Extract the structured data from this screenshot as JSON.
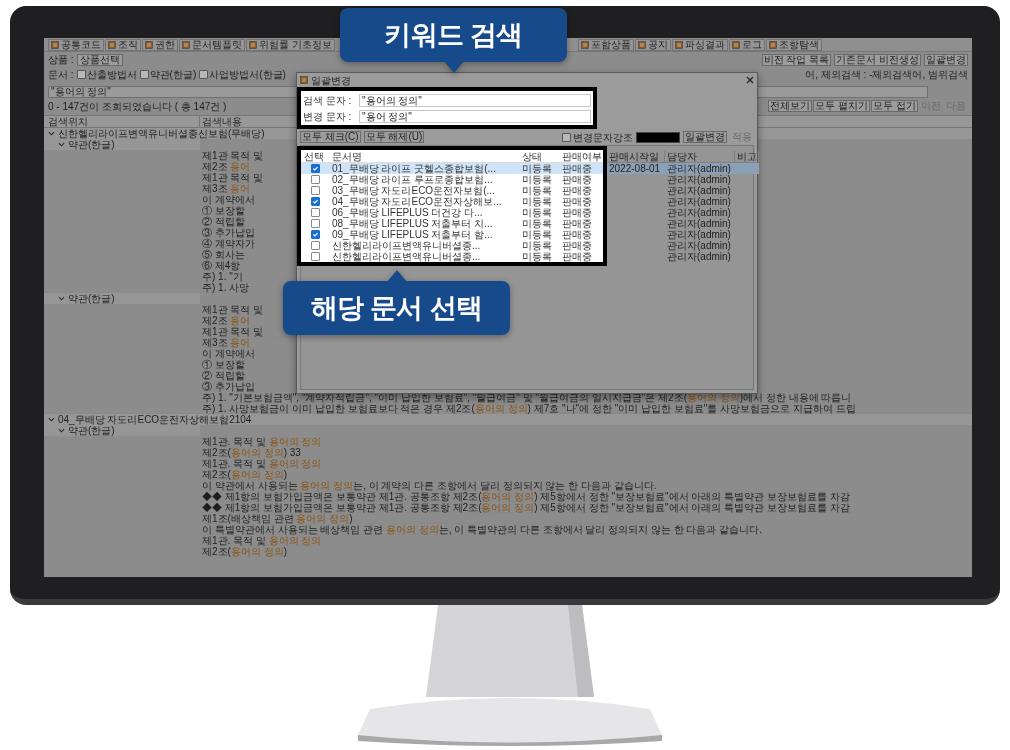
{
  "callouts": [
    {
      "text": "키워드 검색",
      "kind": "down"
    },
    {
      "text": "해당 문서 선택",
      "kind": "up"
    }
  ],
  "app": {
    "tabs_left": [
      "공통코드",
      "조직",
      "권한",
      "문서템플릿",
      "위험률 기초정보"
    ],
    "tabs_right": [
      "포함상품",
      "공지",
      "파싱결과",
      "로그",
      "조항탐색"
    ],
    "product": {
      "label": "상품 :",
      "value": "상품선택"
    },
    "top_buttons": [
      "비전 작업 목록",
      "기존문서 비전생성",
      "일괄변경"
    ],
    "documents": {
      "label": "문서 :",
      "options": [
        {
          "label": "산출방법서",
          "checked": false
        },
        {
          "label": "약관(한글)",
          "checked": false
        },
        {
          "label": "사업방법서(한글)",
          "checked": false
        }
      ]
    },
    "search_hint": "어, 제외검색 : -제외검색어, 범위검색",
    "search_value": "\"용어의 정의\"",
    "result_count": "0 - 147건이 조회되었습니다 ( 총 147건 )",
    "result_buttons": [
      {
        "label": "전체보기",
        "disabled": false
      },
      {
        "label": "모두 펼치기",
        "disabled": false
      },
      {
        "label": "모두 접기",
        "disabled": false
      },
      {
        "label": "이전",
        "disabled": true
      },
      {
        "label": "다음",
        "disabled": true
      }
    ],
    "columns": [
      "검색위치",
      "검색내용"
    ],
    "groups": [
      {
        "title": "신한헬리라이프변액유니버셜종신보험(무배당)",
        "expanded": true,
        "children": [
          {
            "title": "약관(한글)",
            "expanded": true,
            "lines": [
              [
                {
                  "text": "제1관 목적 및"
                }
              ],
              [
                {
                  "text": "제2조 "
                },
                {
                  "text": "용어",
                  "highlight": true
                }
              ],
              [
                {
                  "text": "제1관 목적 및"
                }
              ],
              [
                {
                  "text": "제3조 "
                },
                {
                  "text": "용어",
                  "highlight": true
                }
              ],
              [
                {
                  "text": "이 계약에서"
                }
              ],
              [
                {
                  "text": "① 보장할"
                }
              ],
              [
                {
                  "text": "② 적립할"
                }
              ],
              [
                {
                  "text": "③ 추가납입"
                }
              ],
              [
                {
                  "text": "④ 계약자가"
                }
              ],
              [
                {
                  "text": "⑤ 회사는"
                }
              ],
              [
                {
                  "text": "⑥ 제4항"
                }
              ],
              [
                {
                  "text": "주) 1. \"기"
                }
              ],
              [
                {
                  "text": "주) 1. 사망"
                }
              ]
            ]
          },
          {
            "title": "약관(한글)",
            "expanded": true,
            "lines": [
              [
                {
                  "text": "제1관 목적 및"
                }
              ],
              [
                {
                  "text": "제2조 "
                },
                {
                  "text": "용어",
                  "highlight": true
                }
              ],
              [
                {
                  "text": "제1관 목적 및"
                }
              ],
              [
                {
                  "text": "제3조 "
                },
                {
                  "text": "용어",
                  "highlight": true
                }
              ],
              [
                {
                  "text": "이 계약에서"
                }
              ],
              [
                {
                  "text": "① 보장할"
                }
              ],
              [
                {
                  "text": "② 적립할"
                }
              ],
              [
                {
                  "text": "③ 추가납입"
                }
              ],
              [
                {
                  "text": "주) 1. \"기본보험금액\", \"계약자적립금\", \"이미 납입한 보험료\", \"월급여금\" 및 \"월급여금의 일시지급금\"은 제2조("
                },
                {
                  "text": "용어의 정의",
                  "highlight": true
                },
                {
                  "text": ")에서 정한 내용에 따릅니"
                }
              ],
              [
                {
                  "text": "주) 1. 사망보험금이 이미 납입한 보험료보다 적은 경우 제2조("
                },
                {
                  "text": "용어의 정의",
                  "highlight": true
                },
                {
                  "text": ") 제7호 \"나\"에 정한 \"이미 납입한 보험료\"를 사망보험금으로 지급하여 드립"
                }
              ]
            ]
          }
        ]
      },
      {
        "title": "04_무배당 자도리ECO운전자상해보험2104",
        "expanded": true,
        "children": [
          {
            "title": "약관(한글)",
            "expanded": true,
            "lines": [
              [
                {
                  "text": "제1관. 목적 및 "
                },
                {
                  "text": "용어의 정의",
                  "highlight": true
                }
              ],
              [
                {
                  "text": "제2조("
                },
                {
                  "text": "용어의 정의",
                  "highlight": true
                },
                {
                  "text": ") 33"
                }
              ],
              [
                {
                  "text": "제1관. 목적 및 "
                },
                {
                  "text": "용어의 정의",
                  "highlight": true
                }
              ],
              [
                {
                  "text": "제2조("
                },
                {
                  "text": "용어의 정의",
                  "highlight": true
                },
                {
                  "text": ")"
                }
              ],
              [
                {
                  "text": "이 약관에서 사용되는 "
                },
                {
                  "text": "용어의 정의",
                  "highlight": true
                },
                {
                  "text": "는, 이 계약의 다른 조항에서 달리 정의되지 않는 한 다음과 같습니다."
                }
              ],
              [
                {
                  "text": "◆◆ 제1항의 보험가입금액은 보통약관 제1관. 공통조항 제2조("
                },
                {
                  "text": "용어의 정의",
                  "highlight": true
                },
                {
                  "text": ") 제5항에서 정한 \"보장보험료\"에서 아래의 특별약관 보장보험료를 차감"
                }
              ],
              [
                {
                  "text": "◆◆ 제1항의 보험가입금액은 보통약관 제1관. 공통조항 제2조("
                },
                {
                  "text": "용어의 정의",
                  "highlight": true
                },
                {
                  "text": ") 제5항에서 정한 \"보장보험료\"에서 아래의 특별약관 보장보험료를 차감"
                }
              ],
              [
                {
                  "text": "제1조(배상책임 관련 "
                },
                {
                  "text": "용어의 정의",
                  "highlight": true
                },
                {
                  "text": ")"
                }
              ],
              [
                {
                  "text": "이 특별약관에서 사용되는 배상책임 관련 "
                },
                {
                  "text": "용어의 정의",
                  "highlight": true
                },
                {
                  "text": "는, 이 특별약관의 다른 조항에서 달리 정의되지 않는 한 다음과 같습니다."
                }
              ],
              [
                {
                  "text": "제1관. 목적 및 "
                },
                {
                  "text": "용어의 정의",
                  "highlight": true
                }
              ],
              [
                {
                  "text": "제2조("
                },
                {
                  "text": "용어의 정의",
                  "highlight": true
                },
                {
                  "text": ")"
                }
              ]
            ]
          }
        ]
      }
    ]
  },
  "dialog": {
    "title": "일괄변경",
    "fields": [
      {
        "label": "검색 문자 :",
        "value": "\"용어의 정의\""
      },
      {
        "label": "변경 문자 :",
        "value": "\"용어 정의\""
      }
    ],
    "left_buttons": [
      "모두 체크(C)",
      "모두 해제(U)"
    ],
    "emphasis": {
      "label": "변경문자강조",
      "checked": false,
      "color": "#000000"
    },
    "apply_buttons": [
      {
        "label": "일괄변경",
        "disabled": false
      },
      {
        "label": "적용",
        "disabled": true
      }
    ],
    "columns": [
      "선택",
      "문서명",
      "상태",
      "판매여부",
      "판매시작일",
      "담당자",
      "비고"
    ],
    "rows": [
      {
        "checked": true,
        "name": "01_무배당 라이프 굿헬스종합보험(...",
        "status": "미등록",
        "sale": "판매중",
        "start": "2022-08-01",
        "manager": "관리자(admin)",
        "selected": true
      },
      {
        "checked": false,
        "name": "02_무배당 라이프 루프로종합보험...",
        "status": "미등록",
        "sale": "판매중",
        "manager": "관리자(admin)",
        "selected": false
      },
      {
        "checked": false,
        "name": "03_무배당 자도리ECO운전자보험(...",
        "status": "미등록",
        "sale": "판매중",
        "manager": "관리자(admin)",
        "selected": false
      },
      {
        "checked": true,
        "name": "04_무배당 자도리ECO운전자상해보...",
        "status": "미등록",
        "sale": "판매중",
        "manager": "관리자(admin)",
        "selected": false
      },
      {
        "checked": false,
        "name": "06_무배당 LIFEPLUS 더건강 다...",
        "status": "미등록",
        "sale": "판매중",
        "manager": "관리자(admin)",
        "selected": false
      },
      {
        "checked": false,
        "name": "08_무배당 LIFEPLUS 저출부터 치...",
        "status": "미등록",
        "sale": "판매중",
        "manager": "관리자(admin)",
        "selected": false
      },
      {
        "checked": true,
        "name": "09_무배당 LIFEPLUS 저출부터 함...",
        "status": "미등록",
        "sale": "판매중",
        "manager": "관리자(admin)",
        "selected": false
      },
      {
        "checked": false,
        "name": "신한헬리라이프변액유니버셜종...",
        "status": "미등록",
        "sale": "판매중",
        "manager": "관리자(admin)",
        "selected": false
      },
      {
        "checked": false,
        "name": "신한헬리라이프변액유니버셜종...",
        "status": "미등록",
        "sale": "판매중",
        "manager": "관리자(admin)",
        "selected": false
      }
    ]
  }
}
